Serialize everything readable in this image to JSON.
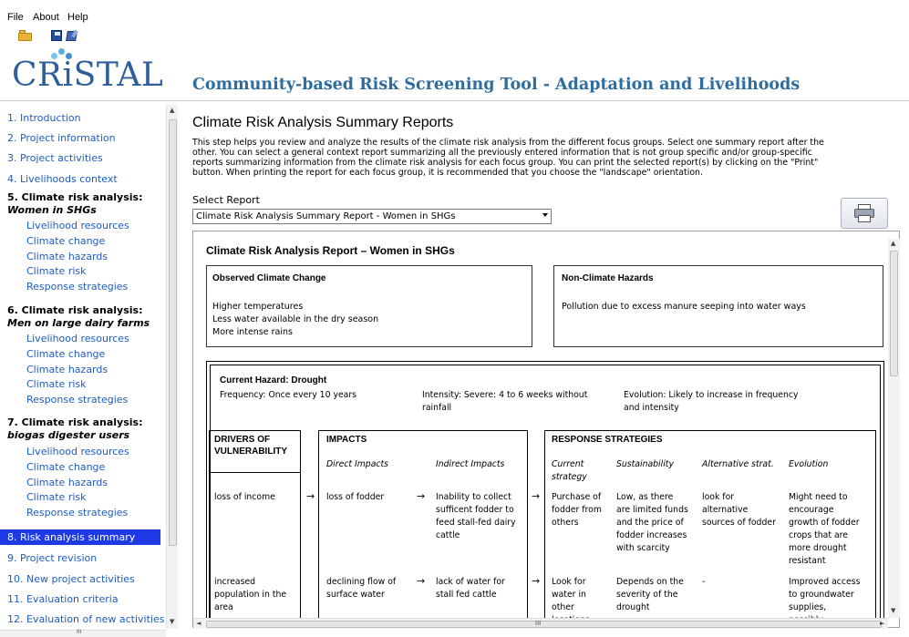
{
  "menu": {
    "file": "File",
    "about": "About",
    "help": "Help"
  },
  "toolbar": {
    "open_icon": "folder-open-icon",
    "save_icon": "save-icon",
    "save_as_icon": "save-as-icon"
  },
  "header": {
    "logo": "CRiSTAL",
    "title": "Community-based Risk Screening Tool - Adaptation and Livelihoods",
    "logo_dot_colors": [
      "#5aaee0",
      "#3f8fce",
      "#7cc3ec"
    ]
  },
  "sidebar": {
    "items": [
      {
        "label": "1. Introduction"
      },
      {
        "label": "2. Project information"
      },
      {
        "label": "3. Project activities"
      },
      {
        "label": "4. Livelihoods context"
      }
    ],
    "group5": {
      "title": "5. Climate risk analysis:",
      "subtitle": "Women in SHGs",
      "subs": [
        "Livelihood resources",
        "Climate change",
        "Climate hazards",
        "Climate risk",
        "Response strategies"
      ]
    },
    "group6": {
      "title": "6. Climate risk analysis:",
      "subtitle": "Men on large dairy farms",
      "subs": [
        "Livelihood resources",
        "Climate change",
        "Climate hazards",
        "Climate risk",
        "Response strategies"
      ]
    },
    "group7": {
      "title": "7. Climate risk analysis:",
      "subtitle": "biogas digester users",
      "subs": [
        "Livelihood resources",
        "Climate change",
        "Climate hazards",
        "Climate risk",
        "Response strategies"
      ]
    },
    "active": "8. Risk analysis summary",
    "after": [
      {
        "label": "9. Project revision"
      },
      {
        "label": "10. New project activities"
      },
      {
        "label": "11. Evaluation criteria"
      },
      {
        "label": "12. Evaluation of new activities"
      }
    ],
    "hscroll_grip": "III"
  },
  "main": {
    "heading": "Climate Risk Analysis Summary Reports",
    "intro_lines": [
      "This step helps you review and analyze the results of the climate risk analysis from the different focus groups. Select one summary report after the",
      "other. You can select a general context report summarizing all the previously entered information that is not group specific and/or group-specific",
      "reports summarizing information from the climate risk analysis for each focus group. You can print the selected report(s) by clicking on the \"Print\"",
      "button. When printing the report for each focus group, it is recommended that you choose the \"landscape\" orientation."
    ],
    "select_label": "Select Report",
    "select_value": "Climate Risk Analysis Summary Report - Women in SHGs",
    "print_icon": "printer-icon"
  },
  "report": {
    "title": "Climate Risk Analysis Report – Women in SHGs",
    "observed": {
      "title": "Observed Climate Change",
      "lines": [
        "Higher temperatures",
        "Less water available in the dry season",
        "More intense rains"
      ]
    },
    "non_climate": {
      "title": "Non-Climate Hazards",
      "text": "Pollution due to excess manure seeping into water ways"
    },
    "hazard": {
      "title": "Current Hazard: Drought",
      "frequency": "Frequency: Once every 10 years",
      "intensity_1": "Intensity: Severe: 4 to 6 weeks without",
      "intensity_2": "rainfall",
      "evolution_1": "Evolution: Likely to increase in frequency",
      "evolution_2": "and intensity"
    },
    "columns": {
      "drivers_1": "DRIVERS OF",
      "drivers_2": "VULNERABILITY",
      "impacts": "IMPACTS",
      "direct": "Direct Impacts",
      "indirect": "Indirect Impacts",
      "responses": "RESPONSE STRATEGIES",
      "current_1": "Current",
      "current_2": "strategy",
      "sustainability": "Sustainability",
      "alternative": "Alternative strat.",
      "evolution": "Evolution"
    },
    "row1": {
      "driver": "loss of income",
      "direct": "loss of fodder",
      "indirect": [
        "Inability to collect",
        "sufficent fodder to",
        "feed stall-fed dairy",
        "cattle"
      ],
      "current": [
        "Purchase of",
        "fodder from",
        "others"
      ],
      "sustainability": [
        "Low, as there",
        "are limited funds",
        "and the price of",
        "fodder increases",
        "with scarcity"
      ],
      "alternative": [
        "look for",
        "alternative",
        "sources of fodder"
      ],
      "evolution": [
        "Might need to",
        "encourage",
        "growth of fodder",
        "crops that are",
        "more drought",
        "resistant"
      ]
    },
    "row2": {
      "driver": [
        "increased",
        "population in the",
        "area"
      ],
      "direct": [
        "declining flow of",
        "surface water"
      ],
      "indirect": [
        "lack of water for",
        "stall fed cattle"
      ],
      "current": [
        "Look for",
        "water in",
        "other",
        "locations"
      ],
      "sustainability": [
        "Depends on the",
        "severity of the",
        "drought"
      ],
      "alternative": "-",
      "evolution": [
        "Improved access",
        "to groundwater",
        "supplies,",
        "possibly"
      ]
    },
    "arrow": "→"
  },
  "colors": {
    "link": "#1f5cc0",
    "active_bg": "#1e3ae6",
    "title": "#2f6d9e"
  }
}
